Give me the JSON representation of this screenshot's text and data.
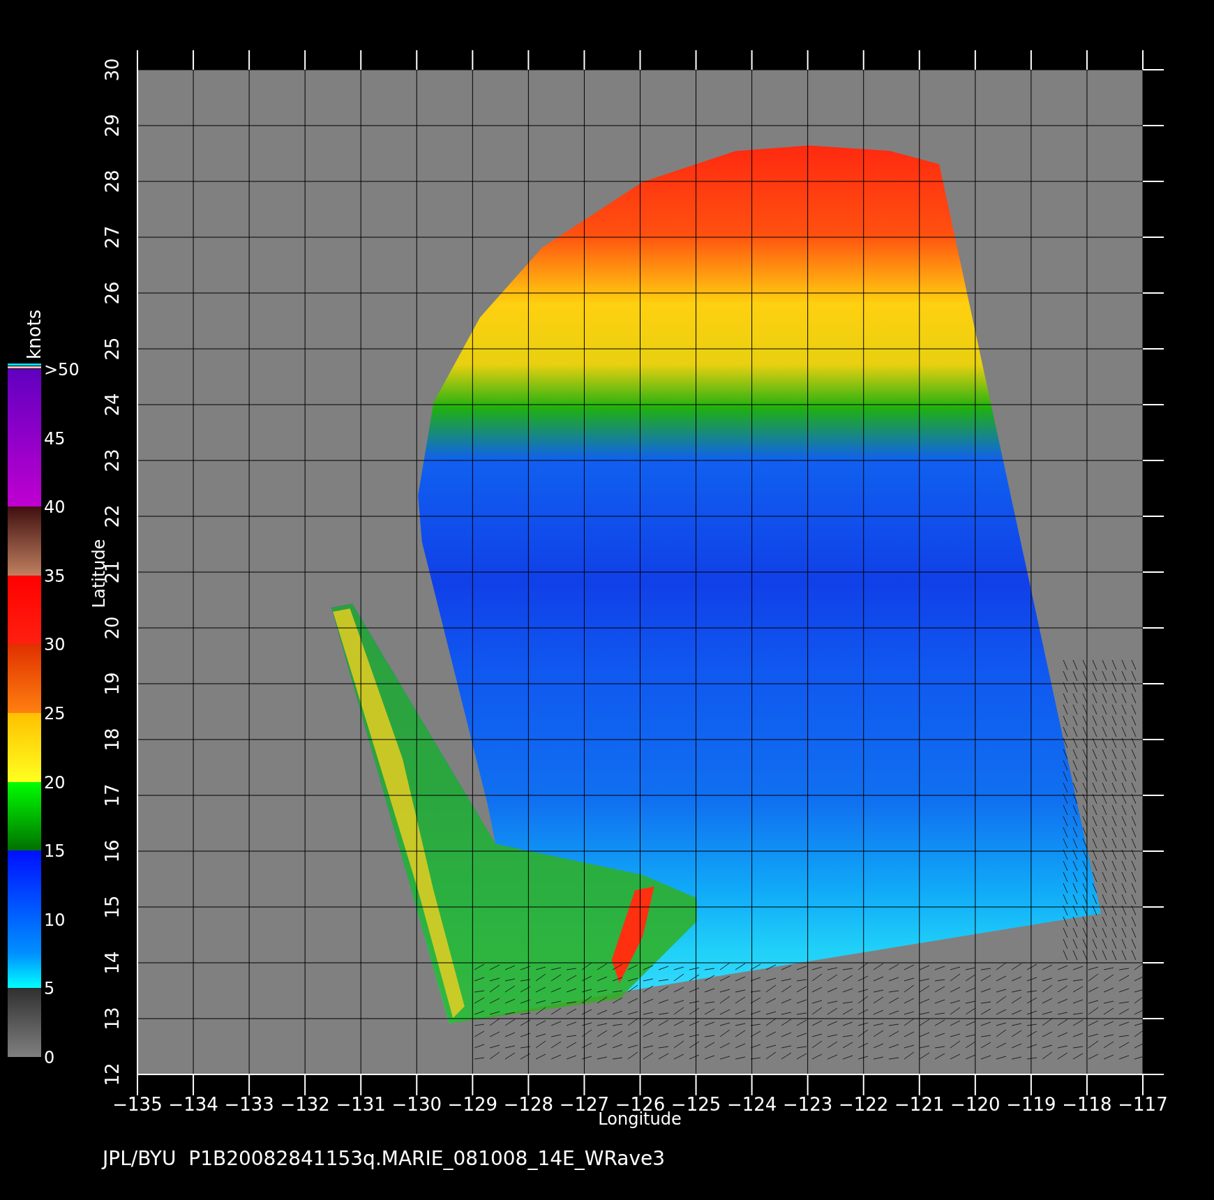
{
  "colorbar": {
    "title": "knots",
    "labels": [
      ">50",
      "45",
      "40",
      "35",
      "30",
      "25",
      "20",
      "15",
      "10",
      "5",
      "0"
    ]
  },
  "plot": {
    "ylabel": "Latitude",
    "xlabel": "Longitude",
    "xticks": [
      "−135",
      "−134",
      "−133",
      "−132",
      "−131",
      "−130",
      "−129",
      "−128",
      "−127",
      "−126",
      "−125",
      "−124",
      "−123",
      "−122",
      "−121",
      "−120",
      "−119",
      "−118",
      "−117"
    ],
    "yticks": [
      "12",
      "13",
      "14",
      "15",
      "16",
      "17",
      "18",
      "19",
      "20",
      "21",
      "22",
      "23",
      "24",
      "25",
      "26",
      "27",
      "28",
      "29",
      "30"
    ]
  },
  "caption": "JPL/BYU  P1B20082841153q.MARIE_081008_14E_WRave3"
}
